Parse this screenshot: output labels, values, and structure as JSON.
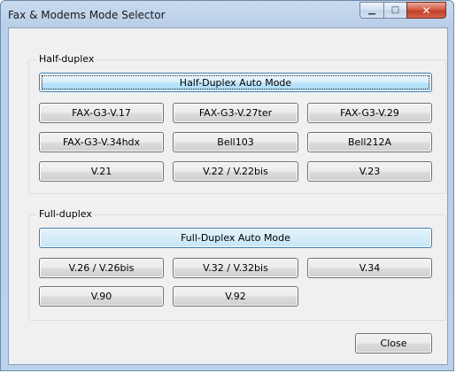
{
  "window": {
    "title": "Fax & Modems Mode Selector",
    "controls": {
      "minimize": "▁",
      "maximize": "□",
      "close": "✕"
    }
  },
  "half_duplex": {
    "label": "Half-duplex",
    "auto_mode": "Half-Duplex Auto Mode",
    "modes": [
      "FAX-G3-V.17",
      "FAX-G3-V.27ter",
      "FAX-G3-V.29",
      "FAX-G3-V.34hdx",
      "Bell103",
      "Bell212A",
      "V.21",
      "V.22 / V.22bis",
      "V.23"
    ]
  },
  "full_duplex": {
    "label": "Full-duplex",
    "auto_mode": "Full-Duplex Auto Mode",
    "modes": [
      "V.26 / V.26bis",
      "V.32 / V.32bis",
      "V.34",
      "V.90",
      "V.92"
    ]
  },
  "footer": {
    "close_label": "Close"
  },
  "colors": {
    "accent": "#3c7fb1",
    "close_button": "#c23f26"
  }
}
